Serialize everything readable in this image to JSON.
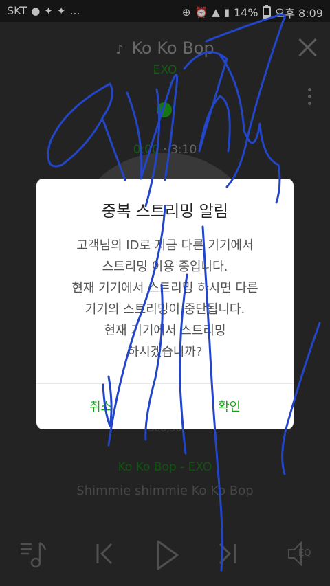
{
  "status_bar": {
    "carrier": "SKT",
    "battery": "14%",
    "time": "오후 8:09"
  },
  "player": {
    "song_title": "Ko Ko Bop",
    "artist": "EXO",
    "time_current": "0:00",
    "time_separator": " · ",
    "time_total": "3:10",
    "play_count": "300,90",
    "lyric_header": "Ko Ko Bop - EXO",
    "lyric_line": "Shimmie shimmie Ko Ko Bop",
    "eq_label": "EQ"
  },
  "dialog": {
    "title": "중복 스트리밍 알림",
    "body_lines": [
      "고객님의 ID로 지금 다른 기기에서",
      "스트리밍 이용 중입니다.",
      "현재 기기에서 스트리밍 하시면 다른",
      "기기의 스트리밍이 중단됩니다.",
      "현재 기기에서 스트리밍",
      "하시겠습니까?"
    ],
    "cancel_label": "취소",
    "confirm_label": "확인"
  },
  "colors": {
    "accent": "#1aa31a",
    "scribble": "#2346c8"
  }
}
